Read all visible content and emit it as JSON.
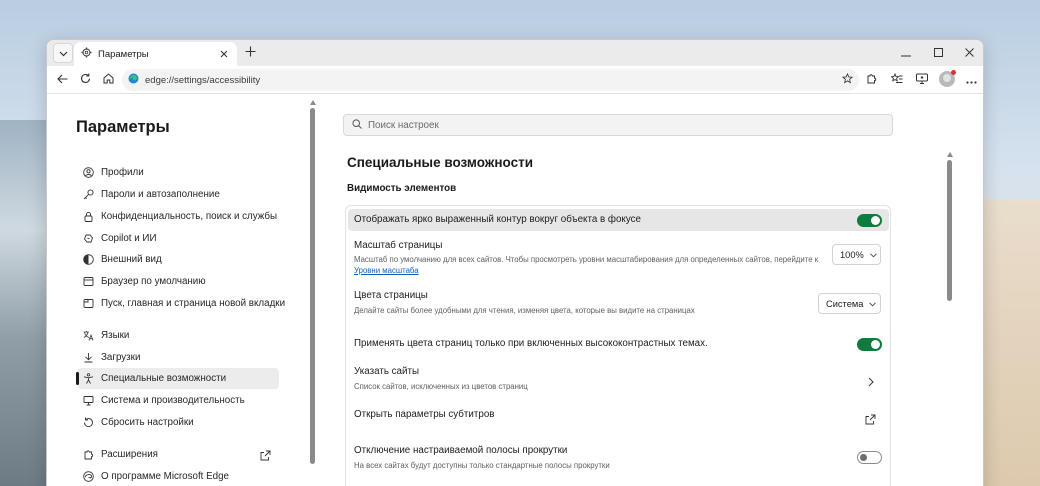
{
  "browser": {
    "tab_title": "Параметры",
    "url": "edge://settings/accessibility"
  },
  "sidebar": {
    "title": "Параметры",
    "groups": [
      [
        {
          "label": "Профили",
          "icon": "profile-icon"
        },
        {
          "label": "Пароли и автозаполнение",
          "icon": "key-icon"
        },
        {
          "label": "Конфиденциальность, поиск и службы",
          "icon": "lock-icon"
        },
        {
          "label": "Copilot и ИИ",
          "icon": "copilot-icon"
        },
        {
          "label": "Внешний вид",
          "icon": "appearance-icon"
        },
        {
          "label": "Браузер по умолчанию",
          "icon": "browser-icon"
        },
        {
          "label": "Пуск, главная и страница новой вкладки",
          "icon": "newtab-icon"
        }
      ],
      [
        {
          "label": "Языки",
          "icon": "languages-icon"
        },
        {
          "label": "Загрузки",
          "icon": "download-icon"
        },
        {
          "label": "Специальные возможности",
          "icon": "accessibility-icon",
          "active": true
        },
        {
          "label": "Система и производительность",
          "icon": "system-icon"
        },
        {
          "label": "Сбросить настройки",
          "icon": "reset-icon"
        }
      ],
      [
        {
          "label": "Расширения",
          "icon": "extensions-icon"
        },
        {
          "label": "О программе Microsoft Edge",
          "icon": "edge-icon"
        }
      ]
    ]
  },
  "search": {
    "placeholder": "Поиск настроек"
  },
  "main": {
    "title": "Специальные возможности",
    "section_title": "Видимость элементов",
    "rows": {
      "focus_outline": {
        "title": "Отображать ярко выраженный контур вокруг объекта в фокусе",
        "toggle": true
      },
      "page_zoom": {
        "title": "Масштаб страницы",
        "desc": "Масштаб по умолчанию для всех сайтов. Чтобы просмотреть уровни масштабирования для определенных сайтов, перейдите к",
        "link": "Уровни масштаба",
        "value": "100%"
      },
      "page_colors": {
        "title": "Цвета страницы",
        "desc": "Делайте сайты более удобными для чтения, изменяя цвета, которые вы видите на страницах",
        "value": "Система"
      },
      "high_contrast": {
        "title": "Применять цвета страниц только при включенных высококонтрастных темах.",
        "toggle": true
      },
      "specify_sites": {
        "title": "Указать сайты",
        "desc": "Список сайтов, исключенных из цветов страниц"
      },
      "captions": {
        "title": "Открыть параметры субтитров"
      },
      "scrollbar": {
        "title": "Отключение настраиваемой полосы прокрутки",
        "desc": "На всех сайтах будут доступны только стандартные полосы прокрутки",
        "toggle": false
      }
    }
  },
  "colors": {
    "accent_toggle": "#0f7b3f",
    "link": "#0f5fb8"
  }
}
